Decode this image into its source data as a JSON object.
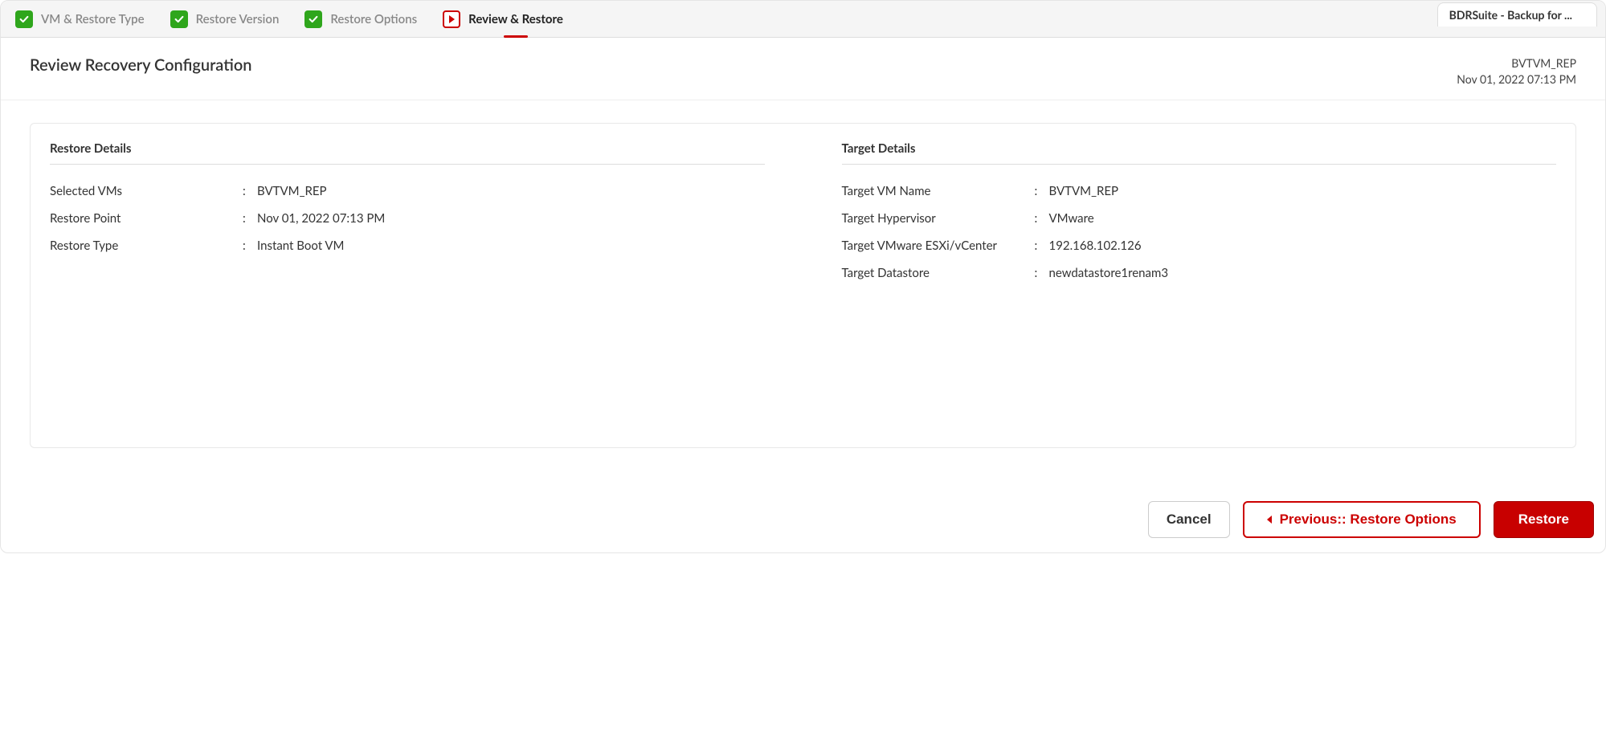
{
  "product_tab": "BDRSuite - Backup for ...",
  "steps": [
    {
      "label": "VM & Restore Type",
      "state": "done"
    },
    {
      "label": "Restore Version",
      "state": "done"
    },
    {
      "label": "Restore Options",
      "state": "done"
    },
    {
      "label": "Review & Restore",
      "state": "current"
    }
  ],
  "page_title": "Review Recovery Configuration",
  "meta": {
    "name": "BVTVM_REP",
    "timestamp": "Nov 01, 2022 07:13 PM"
  },
  "restore_details": {
    "heading": "Restore Details",
    "rows": [
      {
        "k": "Selected VMs",
        "v": "BVTVM_REP"
      },
      {
        "k": "Restore Point",
        "v": "Nov 01, 2022 07:13 PM"
      },
      {
        "k": "Restore Type",
        "v": "Instant Boot VM"
      }
    ]
  },
  "target_details": {
    "heading": "Target Details",
    "rows": [
      {
        "k": "Target VM Name",
        "v": "BVTVM_REP"
      },
      {
        "k": "Target Hypervisor",
        "v": "VMware"
      },
      {
        "k": "Target VMware ESXi/vCenter",
        "v": "192.168.102.126"
      },
      {
        "k": "Target Datastore",
        "v": "newdatastore1renam3"
      }
    ]
  },
  "buttons": {
    "cancel": "Cancel",
    "previous": "Previous:: Restore Options",
    "restore": "Restore"
  }
}
